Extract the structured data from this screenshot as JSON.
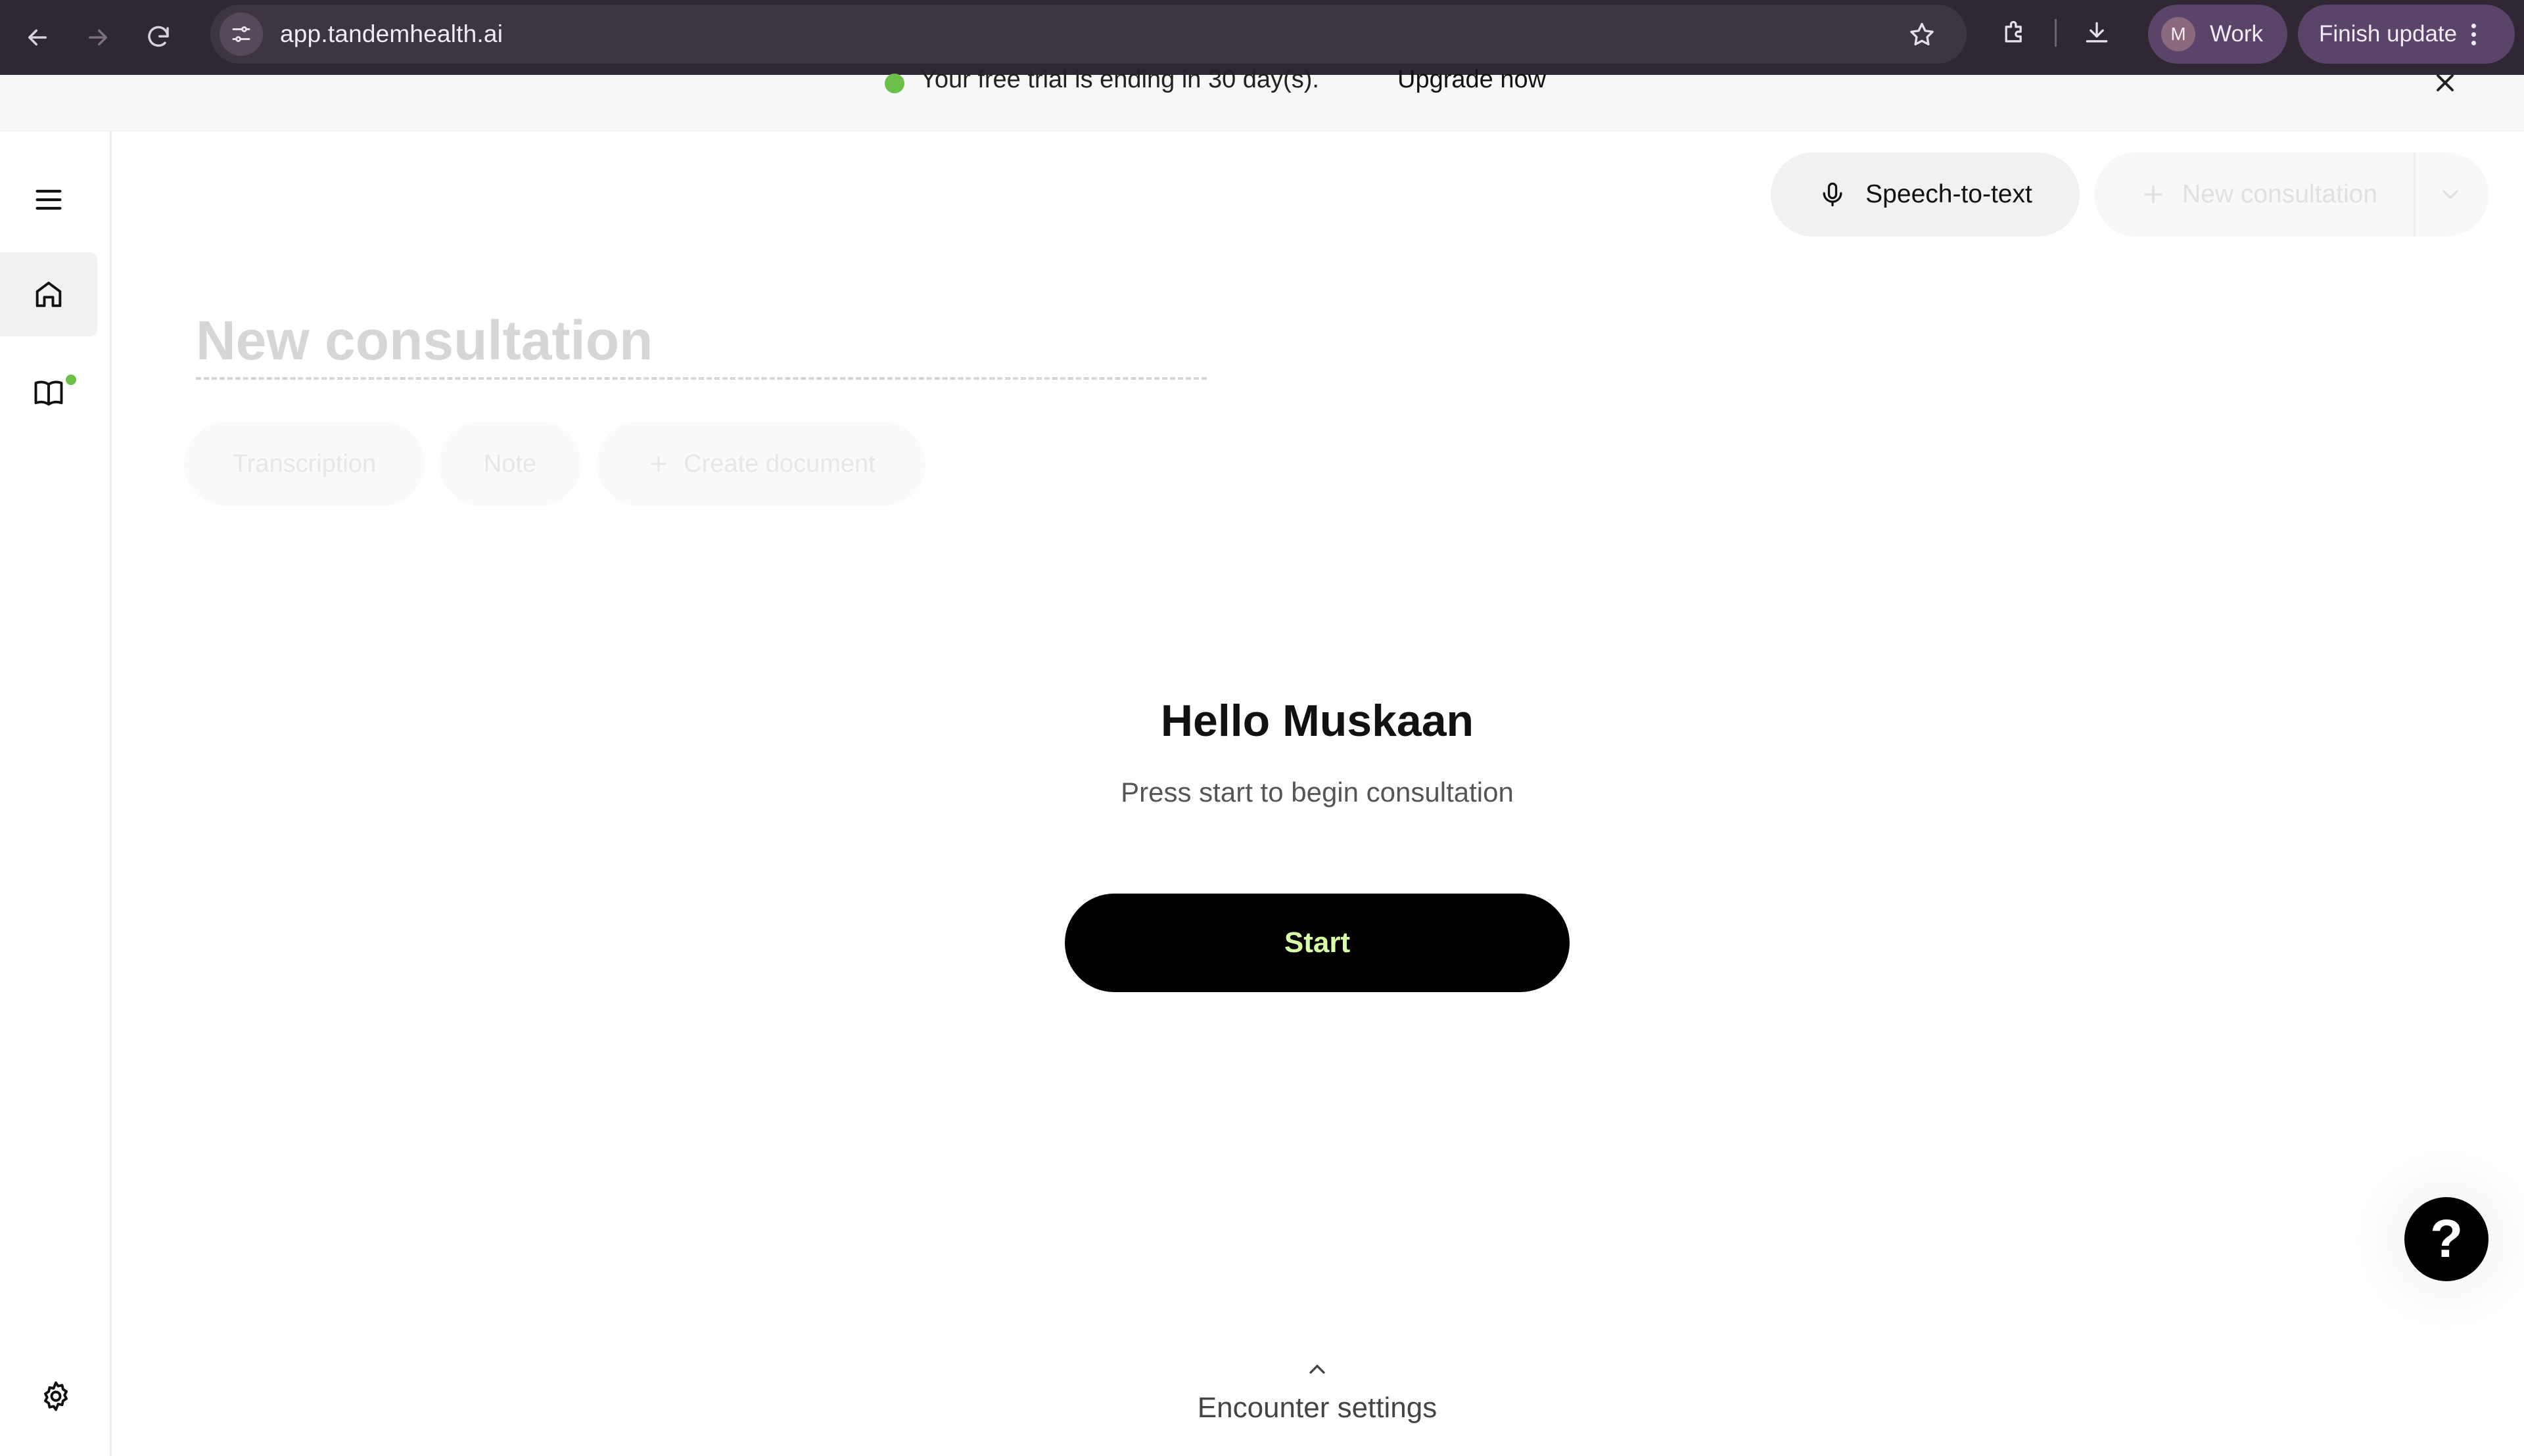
{
  "browser": {
    "url": "app.tandemhealth.ai",
    "profile_initial": "M",
    "profile_label": "Work",
    "update_label": "Finish update"
  },
  "banner": {
    "message": "Your free trial is ending in 30 day(s).",
    "upgrade_label": "Upgrade now"
  },
  "toolbar": {
    "speech_label": "Speech-to-text",
    "new_consultation_label": "New consultation"
  },
  "consultation": {
    "title_placeholder": "New consultation",
    "tabs": [
      {
        "label": "Transcription"
      },
      {
        "label": "Note"
      },
      {
        "label": "Create document"
      }
    ]
  },
  "main": {
    "greeting": "Hello Muskaan",
    "subtext": "Press start to begin consultation",
    "start_label": "Start",
    "help_label": "?",
    "encounter_settings_label": "Encounter settings"
  },
  "colors": {
    "accent_text": "#d9ffa6",
    "status_dot": "#6cc04a",
    "chrome_bg": "#2f2733"
  }
}
